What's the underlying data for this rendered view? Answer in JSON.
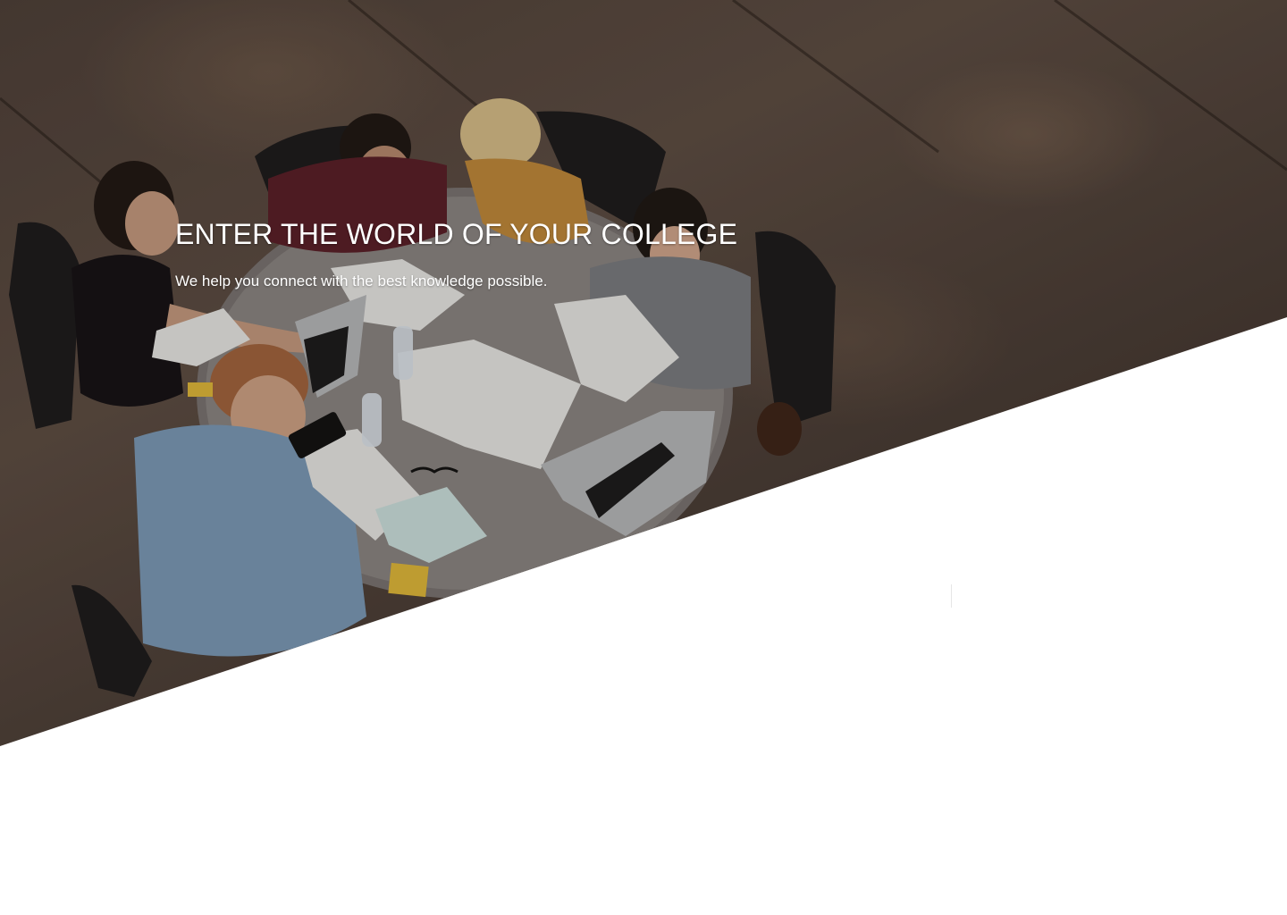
{
  "hero": {
    "title": "ENTER THE WORLD OF YOUR COLLEGE",
    "subtitle": "We help you connect with the best knowledge possible.",
    "image": "students-studying-around-table-photo"
  },
  "colors": {
    "text": "#ffffff",
    "background": "#ffffff",
    "photo_tone": "#4e4039"
  }
}
